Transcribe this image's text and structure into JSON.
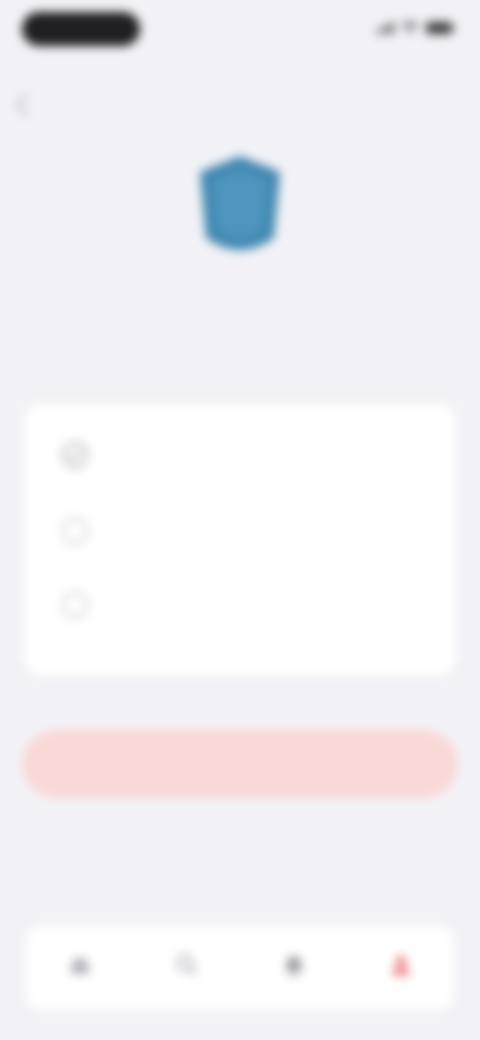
{
  "colors": {
    "background": "#f2f2f6",
    "accent": "#e86f72",
    "accent_light": "#f9d8d8",
    "shield": "#3f87b0"
  },
  "status_bar": {
    "time": "",
    "icons": [
      "signal-icon",
      "wifi-icon",
      "battery-icon"
    ]
  },
  "nav": {
    "back_icon": "chevron-left-icon"
  },
  "hero": {
    "icon": "shield-icon",
    "title": "",
    "subtitle": ""
  },
  "card": {
    "items": [
      {
        "icon": "check-circle-icon",
        "title": "",
        "subtitle": ""
      },
      {
        "icon": "info-circle-icon",
        "title": "",
        "subtitle": ""
      },
      {
        "icon": "info-circle-icon",
        "title": "",
        "subtitle": ""
      }
    ]
  },
  "actions": {
    "primary_label": "",
    "secondary_label": ""
  },
  "tab_bar": {
    "items": [
      {
        "icon": "home-icon",
        "label": "",
        "active": false
      },
      {
        "icon": "search-icon",
        "label": "",
        "active": false
      },
      {
        "icon": "bell-icon",
        "label": "",
        "active": false
      },
      {
        "icon": "profile-icon",
        "label": "",
        "active": true
      }
    ]
  }
}
